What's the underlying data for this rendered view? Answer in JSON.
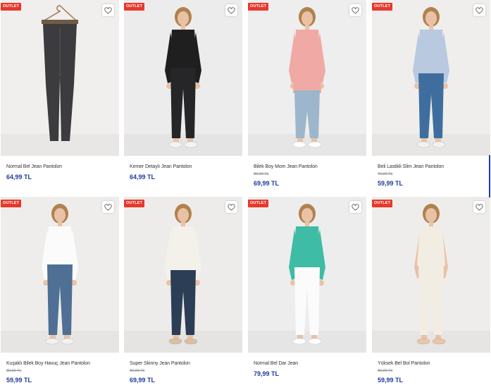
{
  "colors": {
    "price": "#1f3c9c",
    "badge": "#e8382b",
    "image_bg": "#eeeeee"
  },
  "products": [
    {
      "name": "Normal Bel Jean Pantolon",
      "old_price": "",
      "price": "64,99 TL",
      "badge": "OUTLET",
      "favorite_icon": "heart-icon",
      "image": {
        "bg": "#f0efed",
        "top": "none",
        "top_color": "",
        "pants": "#3c3c3e",
        "hanger": true,
        "shoes": "#ffffff"
      }
    },
    {
      "name": "Kemer Detaylı Jean Pantolon",
      "old_price": "",
      "price": "64,99 TL",
      "badge": "OUTLET",
      "favorite_icon": "heart-icon",
      "image": {
        "bg": "#ececec",
        "top": "tee",
        "top_color": "#1f1f1f",
        "pants": "#262628",
        "hanger": false,
        "shoes": "#f4f4f4"
      }
    },
    {
      "name": "Bilek Boy Mom Jean Pantolon",
      "old_price": "89,99 TL",
      "price": "69,99 TL",
      "badge": "OUTLET",
      "favorite_icon": "heart-icon",
      "image": {
        "bg": "#eeeeee",
        "top": "long",
        "top_color": "#f0a9a4",
        "pants": "#9db6cc",
        "hanger": false,
        "shoes": "#ffffff"
      }
    },
    {
      "name": "Beli Lastikli Slim Jean Pantolon",
      "old_price": "79,99 TL",
      "price": "59,99 TL",
      "badge": "OUTLET",
      "favorite_icon": "heart-icon",
      "image": {
        "bg": "#efeeec",
        "top": "shirt",
        "top_color": "#b8c9e0",
        "pants": "#3f6e9e",
        "hanger": false,
        "shoes": "#f2f2f2"
      }
    },
    {
      "name": "Kuşaklı Bilek Boy Havuç Jean Pantolon",
      "old_price": "89,99 TL",
      "price": "59,99 TL",
      "badge": "OUTLET",
      "favorite_icon": "heart-icon",
      "image": {
        "bg": "#eeedeb",
        "top": "tee",
        "top_color": "#fbfbfb",
        "pants": "#4f6f94",
        "hanger": false,
        "shoes": "#f2f2f2"
      }
    },
    {
      "name": "Super Skinny Jean Pantolon",
      "old_price": "89,99 TL",
      "price": "69,99 TL",
      "badge": "OUTLET",
      "favorite_icon": "heart-icon",
      "image": {
        "bg": "#edecea",
        "top": "shirt",
        "top_color": "#f3f1ea",
        "pants": "#2c3e56",
        "hanger": false,
        "shoes": "#d9c0a5"
      }
    },
    {
      "name": "Normal Bel Dar Jean",
      "old_price": "",
      "price": "79,99 TL",
      "badge": "OUTLET",
      "favorite_icon": "heart-icon",
      "image": {
        "bg": "#ededed",
        "top": "hoodie",
        "top_color": "#3fbca6",
        "pants": "#fbfbfb",
        "hanger": false,
        "shoes": "#ffffff"
      }
    },
    {
      "name": "Yüksek Bel Bol Pantolon",
      "old_price": "89,99 TL",
      "price": "59,99 TL",
      "badge": "OUTLET",
      "favorite_icon": "heart-icon",
      "image": {
        "bg": "#eeedec",
        "top": "tank",
        "top_color": "#f2ede2",
        "pants": "#f2ede2",
        "hanger": false,
        "shoes": "#e6c7a8"
      }
    }
  ]
}
